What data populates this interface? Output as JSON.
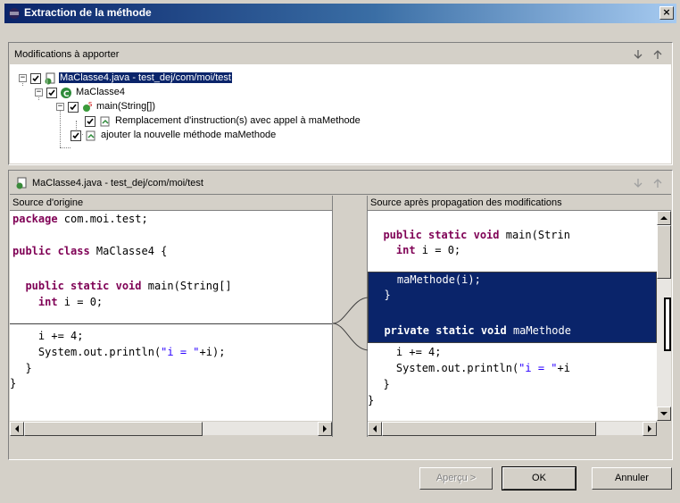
{
  "window": {
    "title": "Extraction de la méthode",
    "close_label": "×"
  },
  "changes_panel": {
    "title": "Modifications à apporter",
    "tree": [
      {
        "label": "MaClasse4.java - test_dej/com/moi/test",
        "expander": "−",
        "checked": true,
        "icon": "java-file-icon",
        "selected": true
      },
      {
        "label": "MaClasse4",
        "expander": "−",
        "checked": true,
        "icon": "class-icon",
        "selected": false
      },
      {
        "label": "main(String[])",
        "expander": "−",
        "checked": true,
        "icon": "method-icon",
        "selected": false
      },
      {
        "label": "Remplacement d'instruction(s) avec appel à maMethode",
        "expander": "",
        "checked": true,
        "icon": "change-icon",
        "selected": false
      },
      {
        "label": "ajouter la nouvelle méthode maMethode",
        "expander": "",
        "checked": true,
        "icon": "change-icon",
        "selected": false
      }
    ]
  },
  "compare_panel": {
    "title": "MaClasse4.java - test_dej/com/moi/test",
    "left": {
      "title": "Source d'origine",
      "lines": [
        {
          "kw": "package",
          "text": " com.moi.test;"
        },
        {
          "kw": "",
          "text": ""
        },
        {
          "kw": "public class",
          "text": " MaClasse4 {"
        },
        {
          "kw": "",
          "text": ""
        },
        {
          "kw": "  public static void",
          "text": " main(String[]"
        },
        {
          "kw": "    int",
          "text": " i = 0;"
        },
        {
          "kw": "",
          "text": ""
        },
        {
          "kw": "",
          "text": "    i += 4;"
        },
        {
          "kw": "",
          "text": "    System.out.println(",
          "str": "\"i = \"",
          "tail": "+i);"
        },
        {
          "kw": "",
          "text": "  }"
        },
        {
          "kw": "",
          "text": "}"
        }
      ]
    },
    "right": {
      "title": "Source après propagation des modifications",
      "lines_top": [
        {
          "kw": "  public static void",
          "text": " main(Strin"
        },
        {
          "kw": "    int",
          "text": " i = 0;"
        }
      ],
      "lines_selected": [
        {
          "kw": "",
          "text": "    maMethode(i);"
        },
        {
          "kw": "",
          "text": "  }"
        },
        {
          "kw": "",
          "text": ""
        },
        {
          "kw": "  private static void",
          "text": " maMethode"
        }
      ],
      "lines_bottom": [
        {
          "kw": "",
          "text": "    i += 4;"
        },
        {
          "kw": "",
          "text": "    System.out.println(",
          "str": "\"i = \"",
          "tail": "+i"
        },
        {
          "kw": "",
          "text": "  }"
        },
        {
          "kw": "",
          "text": "}"
        }
      ]
    }
  },
  "buttons": {
    "preview": "Aperçu >",
    "ok": "OK",
    "cancel": "Annuler"
  }
}
